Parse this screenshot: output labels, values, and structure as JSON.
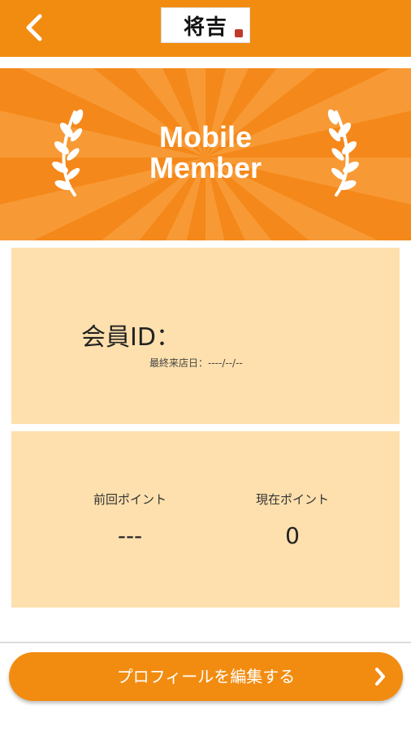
{
  "header": {
    "back_icon": "chevron-left-icon",
    "logo_text": "将吉"
  },
  "banner": {
    "title_line1": "Mobile",
    "title_line2": "Member",
    "icon": "laurel-icon"
  },
  "member_card": {
    "id_label": "会員ID：",
    "last_visit": "最終来店日：----/--/--"
  },
  "points_card": {
    "previous_label": "前回ポイント",
    "previous_value": "---",
    "current_label": "現在ポイント",
    "current_value": "0"
  },
  "footer": {
    "edit_profile_label": "プロフィールを編集する",
    "chevron_icon": "chevron-right-icon"
  },
  "colors": {
    "brand_orange": "#f28c10",
    "card_background": "#fde0ad"
  }
}
